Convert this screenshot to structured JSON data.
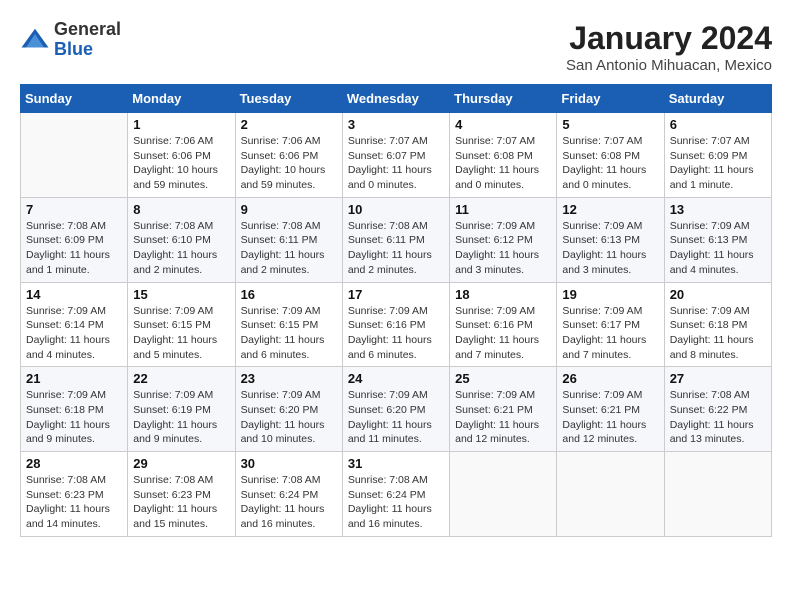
{
  "logo": {
    "general": "General",
    "blue": "Blue"
  },
  "title": "January 2024",
  "subtitle": "San Antonio Mihuacan, Mexico",
  "days_of_week": [
    "Sunday",
    "Monday",
    "Tuesday",
    "Wednesday",
    "Thursday",
    "Friday",
    "Saturday"
  ],
  "weeks": [
    [
      {
        "day": "",
        "info": ""
      },
      {
        "day": "1",
        "info": "Sunrise: 7:06 AM\nSunset: 6:06 PM\nDaylight: 10 hours\nand 59 minutes."
      },
      {
        "day": "2",
        "info": "Sunrise: 7:06 AM\nSunset: 6:06 PM\nDaylight: 10 hours\nand 59 minutes."
      },
      {
        "day": "3",
        "info": "Sunrise: 7:07 AM\nSunset: 6:07 PM\nDaylight: 11 hours\nand 0 minutes."
      },
      {
        "day": "4",
        "info": "Sunrise: 7:07 AM\nSunset: 6:08 PM\nDaylight: 11 hours\nand 0 minutes."
      },
      {
        "day": "5",
        "info": "Sunrise: 7:07 AM\nSunset: 6:08 PM\nDaylight: 11 hours\nand 0 minutes."
      },
      {
        "day": "6",
        "info": "Sunrise: 7:07 AM\nSunset: 6:09 PM\nDaylight: 11 hours\nand 1 minute."
      }
    ],
    [
      {
        "day": "7",
        "info": "Sunrise: 7:08 AM\nSunset: 6:09 PM\nDaylight: 11 hours\nand 1 minute."
      },
      {
        "day": "8",
        "info": "Sunrise: 7:08 AM\nSunset: 6:10 PM\nDaylight: 11 hours\nand 2 minutes."
      },
      {
        "day": "9",
        "info": "Sunrise: 7:08 AM\nSunset: 6:11 PM\nDaylight: 11 hours\nand 2 minutes."
      },
      {
        "day": "10",
        "info": "Sunrise: 7:08 AM\nSunset: 6:11 PM\nDaylight: 11 hours\nand 2 minutes."
      },
      {
        "day": "11",
        "info": "Sunrise: 7:09 AM\nSunset: 6:12 PM\nDaylight: 11 hours\nand 3 minutes."
      },
      {
        "day": "12",
        "info": "Sunrise: 7:09 AM\nSunset: 6:13 PM\nDaylight: 11 hours\nand 3 minutes."
      },
      {
        "day": "13",
        "info": "Sunrise: 7:09 AM\nSunset: 6:13 PM\nDaylight: 11 hours\nand 4 minutes."
      }
    ],
    [
      {
        "day": "14",
        "info": "Sunrise: 7:09 AM\nSunset: 6:14 PM\nDaylight: 11 hours\nand 4 minutes."
      },
      {
        "day": "15",
        "info": "Sunrise: 7:09 AM\nSunset: 6:15 PM\nDaylight: 11 hours\nand 5 minutes."
      },
      {
        "day": "16",
        "info": "Sunrise: 7:09 AM\nSunset: 6:15 PM\nDaylight: 11 hours\nand 6 minutes."
      },
      {
        "day": "17",
        "info": "Sunrise: 7:09 AM\nSunset: 6:16 PM\nDaylight: 11 hours\nand 6 minutes."
      },
      {
        "day": "18",
        "info": "Sunrise: 7:09 AM\nSunset: 6:16 PM\nDaylight: 11 hours\nand 7 minutes."
      },
      {
        "day": "19",
        "info": "Sunrise: 7:09 AM\nSunset: 6:17 PM\nDaylight: 11 hours\nand 7 minutes."
      },
      {
        "day": "20",
        "info": "Sunrise: 7:09 AM\nSunset: 6:18 PM\nDaylight: 11 hours\nand 8 minutes."
      }
    ],
    [
      {
        "day": "21",
        "info": "Sunrise: 7:09 AM\nSunset: 6:18 PM\nDaylight: 11 hours\nand 9 minutes."
      },
      {
        "day": "22",
        "info": "Sunrise: 7:09 AM\nSunset: 6:19 PM\nDaylight: 11 hours\nand 9 minutes."
      },
      {
        "day": "23",
        "info": "Sunrise: 7:09 AM\nSunset: 6:20 PM\nDaylight: 11 hours\nand 10 minutes."
      },
      {
        "day": "24",
        "info": "Sunrise: 7:09 AM\nSunset: 6:20 PM\nDaylight: 11 hours\nand 11 minutes."
      },
      {
        "day": "25",
        "info": "Sunrise: 7:09 AM\nSunset: 6:21 PM\nDaylight: 11 hours\nand 12 minutes."
      },
      {
        "day": "26",
        "info": "Sunrise: 7:09 AM\nSunset: 6:21 PM\nDaylight: 11 hours\nand 12 minutes."
      },
      {
        "day": "27",
        "info": "Sunrise: 7:08 AM\nSunset: 6:22 PM\nDaylight: 11 hours\nand 13 minutes."
      }
    ],
    [
      {
        "day": "28",
        "info": "Sunrise: 7:08 AM\nSunset: 6:23 PM\nDaylight: 11 hours\nand 14 minutes."
      },
      {
        "day": "29",
        "info": "Sunrise: 7:08 AM\nSunset: 6:23 PM\nDaylight: 11 hours\nand 15 minutes."
      },
      {
        "day": "30",
        "info": "Sunrise: 7:08 AM\nSunset: 6:24 PM\nDaylight: 11 hours\nand 16 minutes."
      },
      {
        "day": "31",
        "info": "Sunrise: 7:08 AM\nSunset: 6:24 PM\nDaylight: 11 hours\nand 16 minutes."
      },
      {
        "day": "",
        "info": ""
      },
      {
        "day": "",
        "info": ""
      },
      {
        "day": "",
        "info": ""
      }
    ]
  ]
}
